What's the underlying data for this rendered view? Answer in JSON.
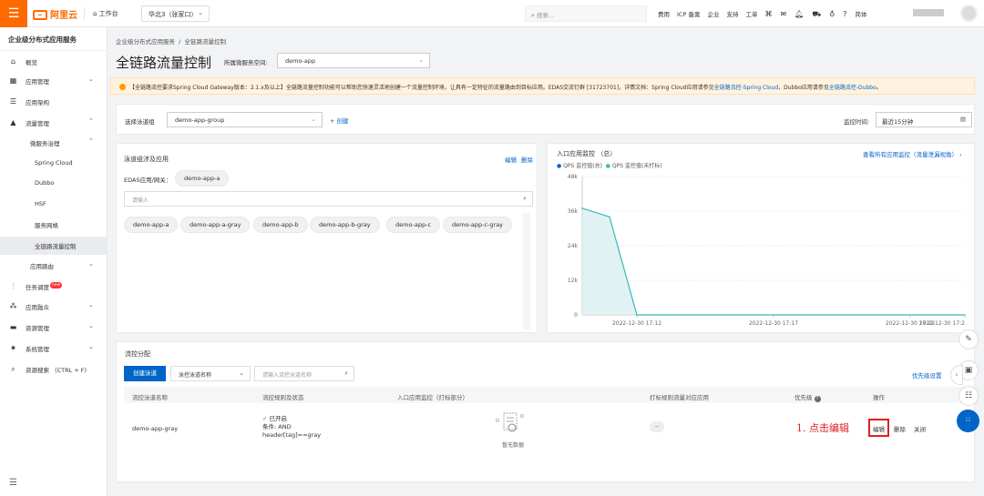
{
  "topbar": {
    "brand": "阿里云",
    "workbench": "工作台",
    "region": "华北3（张家口）",
    "search_placeholder": "搜索...",
    "links": [
      "费用",
      "ICP 备案",
      "企业",
      "支持",
      "工单"
    ],
    "lang": "简体"
  },
  "sidebar": {
    "title": "企业级分布式应用服务",
    "items": [
      {
        "label": "概览",
        "icon": "home-icon"
      },
      {
        "label": "应用管理",
        "icon": "grid-icon",
        "chevron": "down"
      },
      {
        "label": "应用架构",
        "icon": "layers-icon"
      },
      {
        "label": "流量管理",
        "icon": "triangle-icon",
        "chevron": "up"
      },
      {
        "label": "微服务治理",
        "chevron": "up"
      },
      {
        "label": "Spring Cloud"
      },
      {
        "label": "Dubbo"
      },
      {
        "label": "HSF"
      },
      {
        "label": "服务网格"
      },
      {
        "label": "全链路流量控制"
      },
      {
        "label": "应用路由",
        "chevron": "down"
      },
      {
        "label": "任务调度",
        "icon": "tasks-icon",
        "badge": "new"
      },
      {
        "label": "应用融众",
        "icon": "tree-icon",
        "chevron": "down"
      },
      {
        "label": "资源管理",
        "icon": "folder-icon",
        "chevron": "down"
      },
      {
        "label": "系统管理",
        "icon": "gear-icon",
        "chevron": "down"
      },
      {
        "label": "资源搜索 （CTRL + F)",
        "icon": "search-list-icon"
      }
    ]
  },
  "header": {
    "breadcrumb": [
      "企业级分布式应用服务",
      "全链路流量控制"
    ],
    "title": "全链路流量控制",
    "namespace_label": "所属微服务空间:",
    "namespace": "demo-app"
  },
  "notice": {
    "prefix": "【全链路流控要求Spring Cloud Gateway版本：2.1.x及以上】全链路流量控制功能可以帮助您快速灵活地创建一个流量控制环境，让具有一定特征的流量路由到目标应用。EDAS交流钉群 [31723701]，详情文档：Spring Cloud应用请参见",
    "link1": "全链路流控-Spring Cloud",
    "middle": "，Dubbo应用请参见",
    "link2": "全链路流控-Dubbo",
    "suffix": "。"
  },
  "group_bar": {
    "label": "选择泳道组",
    "value": "demo-app-group",
    "create": "+ 创建",
    "time_label": "监控时间:",
    "time_value": "最近15分钟"
  },
  "lane_panel": {
    "title": "泳道组涉及应用",
    "edit": "编辑",
    "delete": "删除",
    "gateway_label": "EDAS应用/网关：",
    "gateway": "demo-app-a",
    "search_placeholder": "请输入",
    "apps": [
      "demo-app-a",
      "demo-app-a-gray",
      "demo-app-b",
      "demo-app-b-gray",
      "demo-app-c",
      "demo-app-c-gray"
    ]
  },
  "monitor": {
    "title": "入口应用监控 （总）",
    "link": "查看所有应用监控（流量泄漏视角）",
    "legend": [
      "QPS 监控值(总)",
      "QPS 监控值(未打标)"
    ]
  },
  "chart_data": {
    "type": "area",
    "x": [
      "2022-12-30 17:10",
      "2022-12-30 17:11",
      "2022-12-30 17:12",
      "2022-12-30 17:13",
      "2022-12-30 17:24"
    ],
    "series": [
      {
        "name": "QPS 监控值(总)",
        "values": [
          37000,
          34000,
          0,
          0,
          0
        ]
      }
    ],
    "yticks": [
      "0",
      "12k",
      "24k",
      "36k",
      "48k"
    ],
    "xticks": [
      "2022-12-30 17:12",
      "2022-12-30 17:17",
      "2022-12-30 17:22",
      "2022-12-30 17:2"
    ],
    "ylim": [
      0,
      48000
    ],
    "colors": {
      "line": "#3bb8b8",
      "fill": "#d8eff0"
    }
  },
  "distribution": {
    "title": "流控分配",
    "create_button": "创建泳道",
    "filter_select": "泳控泳道名称",
    "filter_placeholder": "请输入流控泳道名称",
    "priority_link": "优先级设置",
    "columns": [
      "流控泳道名称",
      "流控规则及状态",
      "入口应用监控（打标部分）",
      "打标规则流量对应应用",
      "优先级",
      "操作"
    ],
    "row": {
      "name": "demo-app-gray",
      "status": "已开启",
      "condition": "条件: AND",
      "rule": "header[tag]==gray",
      "no_data": "暂无数据",
      "apps": "--",
      "actions": [
        "编辑",
        "删除",
        "关闭"
      ]
    },
    "note": "1. 点击编辑"
  }
}
